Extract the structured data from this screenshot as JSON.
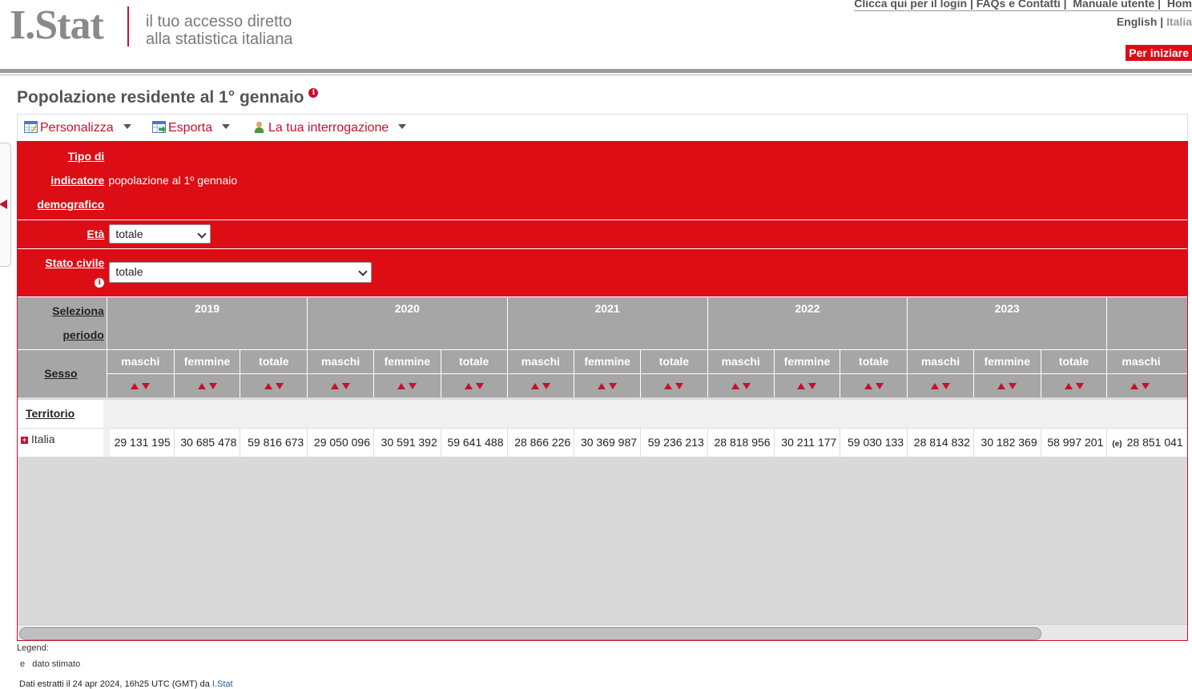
{
  "header": {
    "logo": "I.Stat",
    "tagline_line1": "il tuo accesso diretto",
    "tagline_line2": "alla statistica italiana",
    "links": [
      "Clicca qui per il login",
      "FAQs e Contatti",
      "Manuale utente",
      "Hom"
    ],
    "lang_en": "English",
    "lang_it": "Italia",
    "start_button": "Per iniziare"
  },
  "page": {
    "title": "Popolazione residente al 1° gennaio"
  },
  "toolbar": {
    "customize": "Personalizza",
    "export": "Esporta",
    "query": "La tua interrogazione"
  },
  "filters": {
    "indicator_label": "Tipo di indicatore demografico",
    "indicator_value": "popolazione al 1º gennaio",
    "age_label": "Età",
    "age_value": "totale",
    "civil_label": "Stato civile",
    "civil_value": "totale"
  },
  "table": {
    "period_label": "Seleziona periodo",
    "sex_label": "Sesso",
    "territory_label": "Territorio",
    "years": [
      "2019",
      "2020",
      "2021",
      "2022",
      "2023"
    ],
    "sexes": [
      "maschi",
      "femmine",
      "totale"
    ],
    "extra_col": "maschi",
    "row": {
      "label": "Italia",
      "values": [
        "29 131 195",
        "30 685 478",
        "59 816 673",
        "29 050 096",
        "30 591 392",
        "59 641 488",
        "28 866 226",
        "30 369 987",
        "59 236 213",
        "28 818 956",
        "30 211 177",
        "59 030 133",
        "28 814 832",
        "30 182 369",
        "58 997 201"
      ],
      "extra_flag": "(e)",
      "extra_value": "28 851 041"
    }
  },
  "legend": {
    "title": "Legend:",
    "code": "e",
    "desc": "dato stimato"
  },
  "footer": {
    "text": "Dati estratti il 24 apr 2024, 16h25 UTC (GMT) da",
    "link": "I.Stat"
  }
}
